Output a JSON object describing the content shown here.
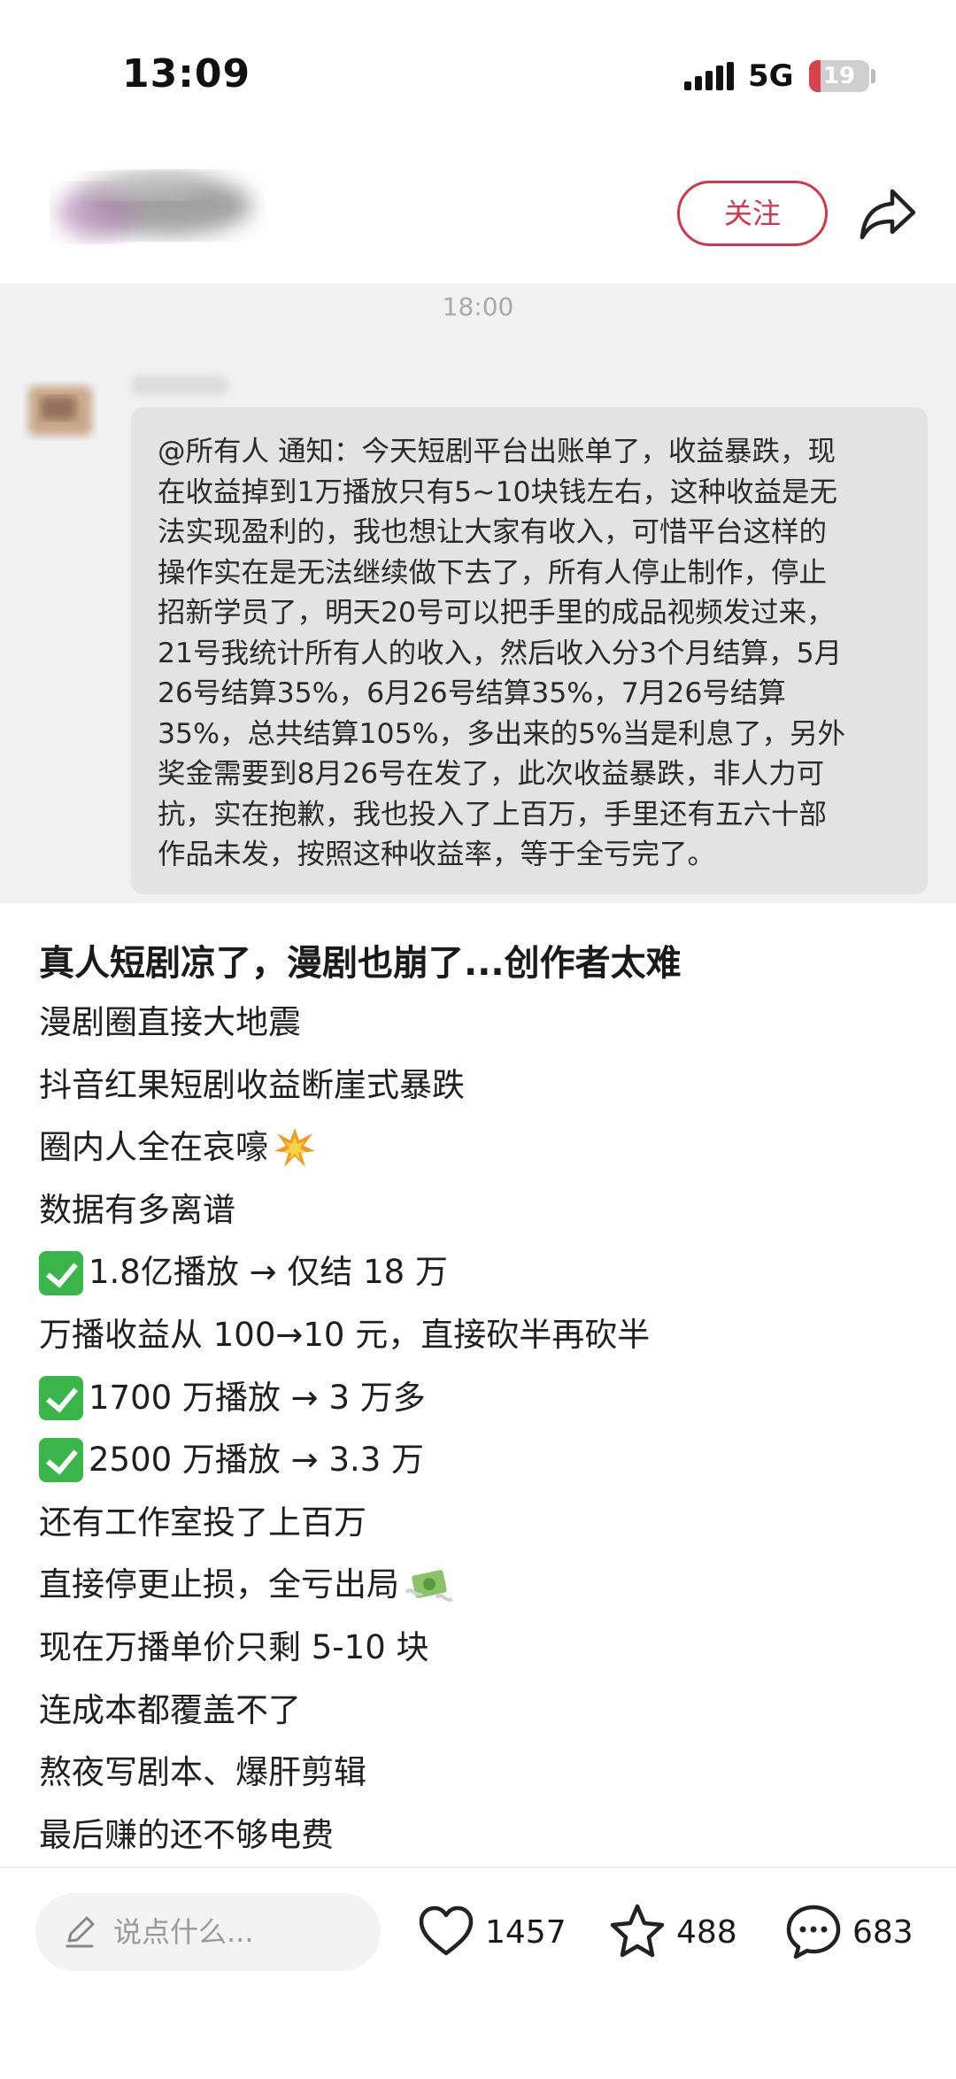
{
  "status_bar": {
    "time": "13:09",
    "network": "5G",
    "battery": "19",
    "battery_level": 0.19
  },
  "header": {
    "follow_label": "关注"
  },
  "chat": {
    "time": "18:00",
    "message_lines": [
      "@所有人 通知：今天短剧平台出账单了，收益暴跌，现",
      "在收益掉到1万播放只有5~10块钱左右，这种收益是无",
      "法实现盈利的，我也想让大家有收入，可惜平台这样的",
      "操作实在是无法继续做下去了，所有人停止制作，停止",
      "招新学员了，明天20号可以把手里的成品视频发过来，",
      "21号我统计所有人的收入，然后收入分3个月结算，5月",
      "26号结算35%，6月26号结算35%，7月26号结算",
      "35%，总共结算105%，多出来的5%当是利息了，另外",
      "奖金需要到8月26号在发了，此次收益暴跌，非人力可",
      "抗，实在抱歉，我也投入了上百万，手里还有五六十部",
      "作品未发，按照这种收益率，等于全亏完了。"
    ]
  },
  "post": {
    "title": "真人短剧凉了，漫剧也崩了...创作者太难",
    "lines": [
      "漫剧圈直接大地震",
      "抖音红果短剧收益断崖式暴跌",
      "圈内人全在哀嚎",
      "数据有多离谱",
      "1.8亿播放 → 仅结 18 万",
      "万播收益从 100→10 元，直接砍半再砍半",
      "1700 万播放 → 3 万多",
      "2500 万播放 → 3.3 万",
      "还有工作室投了上百万",
      "直接停更止损，全亏出局",
      "现在万播单价只剩 5-10 块",
      "连成本都覆盖不了",
      "熬夜写剧本、爆肝剪辑",
      "最后赚的还不够电费"
    ]
  },
  "bottom_bar": {
    "comment_placeholder": "说点什么...",
    "likes": "1457",
    "collects": "488",
    "comments": "683"
  },
  "colors": {
    "accent": "#d0374a",
    "check": "#3ab54a",
    "chat_bg": "#f1f1f1",
    "bubble_bg": "#e3e3e3"
  },
  "icons": {
    "share": "share-arrow-icon",
    "check": "white-check-mark-icon",
    "collision": "collision-icon",
    "money": "money-with-wings-icon",
    "like": "heart-icon",
    "collect": "star-icon",
    "comment": "speech-bubble-icon",
    "pencil": "pencil-icon"
  }
}
